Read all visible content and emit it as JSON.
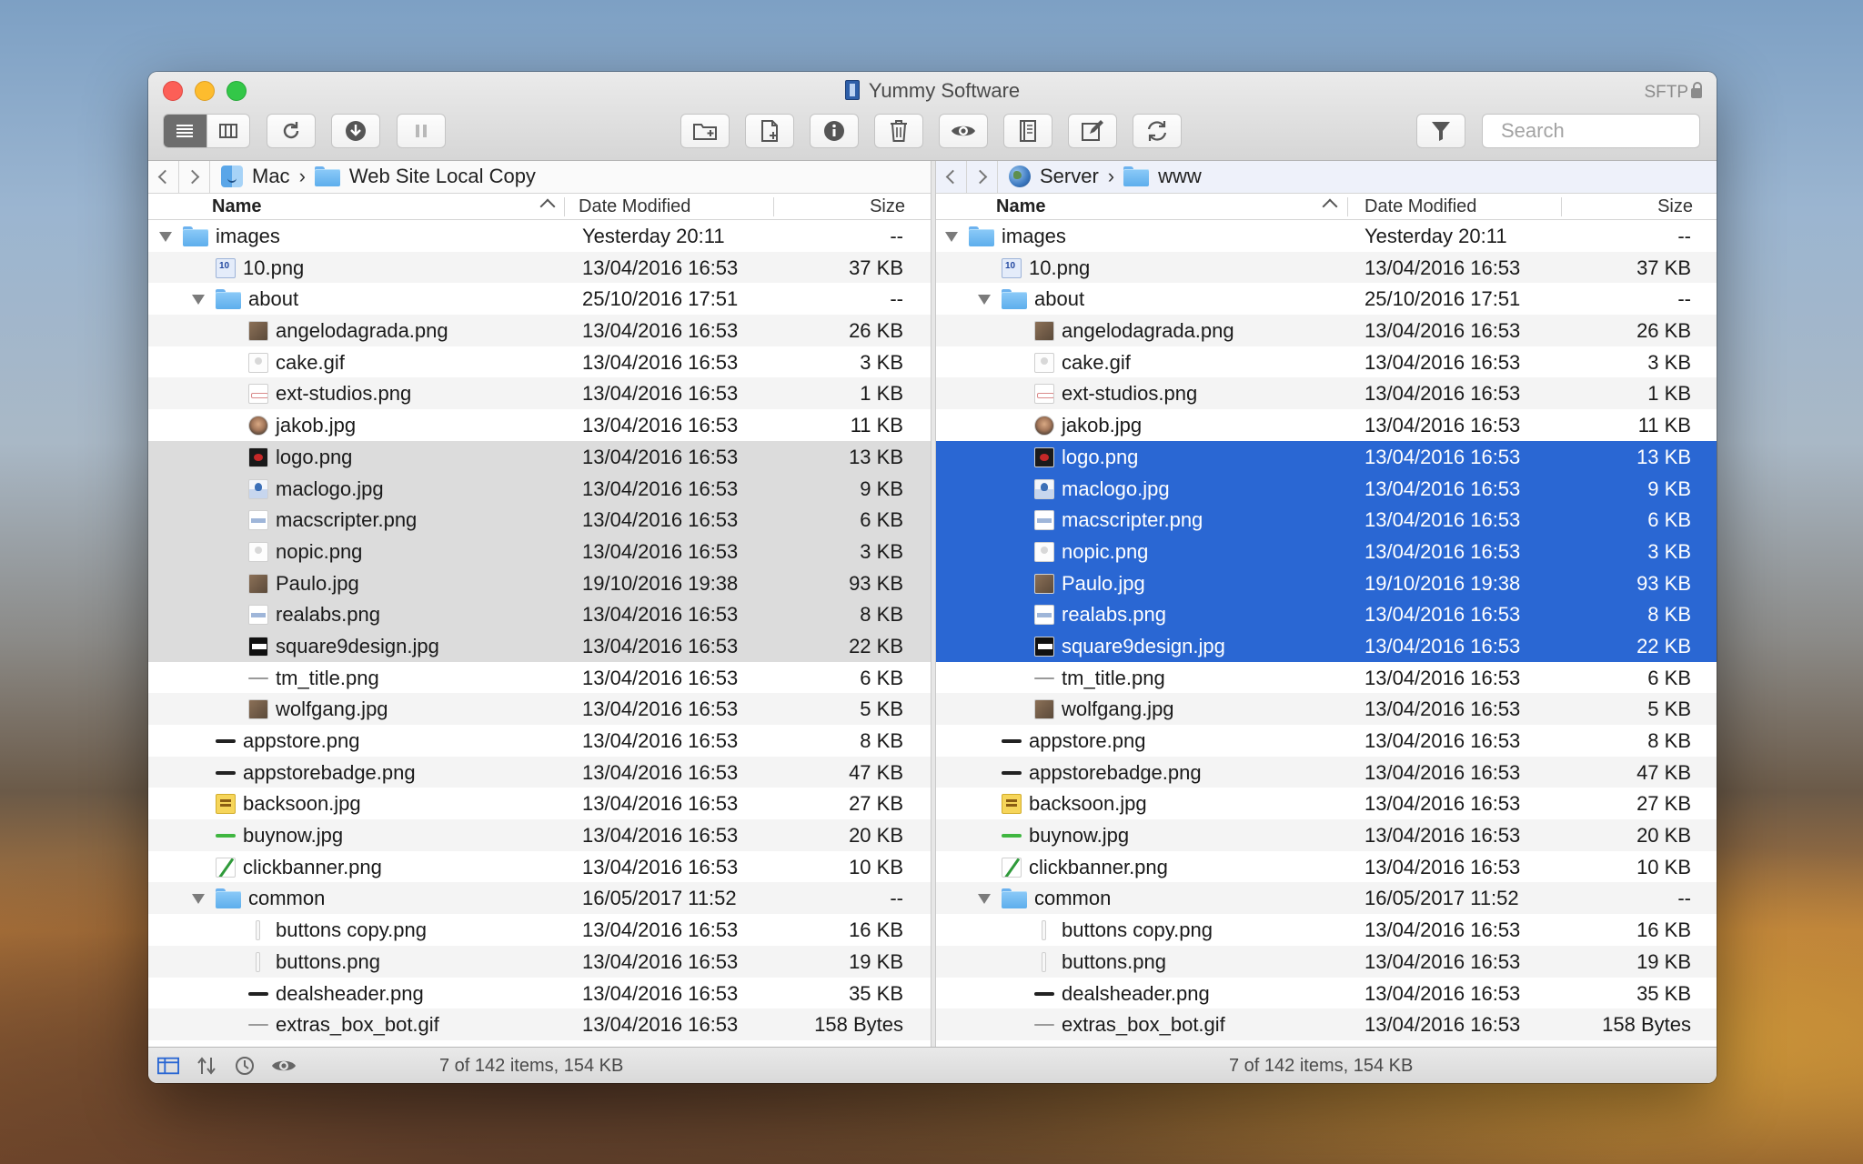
{
  "window": {
    "title": "Yummy Software",
    "protocol": "SFTP"
  },
  "toolbar": {
    "search_placeholder": "Search"
  },
  "left": {
    "crumbs": [
      "Mac",
      "Web Site Local Copy"
    ],
    "columns": {
      "name": "Name",
      "date": "Date Modified",
      "size": "Size"
    },
    "status": "7 of 142 items, 154 KB"
  },
  "right": {
    "crumbs": [
      "Server",
      "www"
    ],
    "columns": {
      "name": "Name",
      "date": "Date Modified",
      "size": "Size"
    },
    "status": "7 of 142 items, 154 KB"
  },
  "rows": [
    {
      "name": "images",
      "date": "Yesterday 20:11",
      "size": "--",
      "depth": 0,
      "type": "folder"
    },
    {
      "name": "10.png",
      "date": "13/04/2016 16:53",
      "size": "37 KB",
      "depth": 1,
      "type": "num"
    },
    {
      "name": "about",
      "date": "25/10/2016 17:51",
      "size": "--",
      "depth": 1,
      "type": "folder"
    },
    {
      "name": "angelodagrada.png",
      "date": "13/04/2016 16:53",
      "size": "26 KB",
      "depth": 2,
      "type": "photo"
    },
    {
      "name": "cake.gif",
      "date": "13/04/2016 16:53",
      "size": "3 KB",
      "depth": 2,
      "type": "blank"
    },
    {
      "name": "ext-studios.png",
      "date": "13/04/2016 16:53",
      "size": "1 KB",
      "depth": 2,
      "type": "red"
    },
    {
      "name": "jakob.jpg",
      "date": "13/04/2016 16:53",
      "size": "11 KB",
      "depth": 2,
      "type": "face"
    },
    {
      "name": "logo.png",
      "date": "13/04/2016 16:53",
      "size": "13 KB",
      "depth": 2,
      "type": "dark",
      "selected": true
    },
    {
      "name": "maclogo.jpg",
      "date": "13/04/2016 16:53",
      "size": "9 KB",
      "depth": 2,
      "type": "mac",
      "selected": true
    },
    {
      "name": "macscripter.png",
      "date": "13/04/2016 16:53",
      "size": "6 KB",
      "depth": 2,
      "type": "strip",
      "selected": true
    },
    {
      "name": "nopic.png",
      "date": "13/04/2016 16:53",
      "size": "3 KB",
      "depth": 2,
      "type": "blank",
      "selected": true
    },
    {
      "name": "Paulo.jpg",
      "date": "19/10/2016 19:38",
      "size": "93 KB",
      "depth": 2,
      "type": "photo",
      "selected": true
    },
    {
      "name": "realabs.png",
      "date": "13/04/2016 16:53",
      "size": "8 KB",
      "depth": 2,
      "type": "strip",
      "selected": true
    },
    {
      "name": "square9design.jpg",
      "date": "13/04/2016 16:53",
      "size": "22 KB",
      "depth": 2,
      "type": "square",
      "selected": true
    },
    {
      "name": "tm_title.png",
      "date": "13/04/2016 16:53",
      "size": "6 KB",
      "depth": 2,
      "type": "thin"
    },
    {
      "name": "wolfgang.jpg",
      "date": "13/04/2016 16:53",
      "size": "5 KB",
      "depth": 2,
      "type": "photo"
    },
    {
      "name": "appstore.png",
      "date": "13/04/2016 16:53",
      "size": "8 KB",
      "depth": 1,
      "type": "bar"
    },
    {
      "name": "appstorebadge.png",
      "date": "13/04/2016 16:53",
      "size": "47 KB",
      "depth": 1,
      "type": "bar"
    },
    {
      "name": "backsoon.jpg",
      "date": "13/04/2016 16:53",
      "size": "27 KB",
      "depth": 1,
      "type": "yellow"
    },
    {
      "name": "buynow.jpg",
      "date": "13/04/2016 16:53",
      "size": "20 KB",
      "depth": 1,
      "type": "green"
    },
    {
      "name": "clickbanner.png",
      "date": "13/04/2016 16:53",
      "size": "10 KB",
      "depth": 1,
      "type": "pencil"
    },
    {
      "name": "common",
      "date": "16/05/2017 11:52",
      "size": "--",
      "depth": 1,
      "type": "folder"
    },
    {
      "name": "buttons copy.png",
      "date": "13/04/2016 16:53",
      "size": "16 KB",
      "depth": 2,
      "type": "slim"
    },
    {
      "name": "buttons.png",
      "date": "13/04/2016 16:53",
      "size": "19 KB",
      "depth": 2,
      "type": "slim"
    },
    {
      "name": "dealsheader.png",
      "date": "13/04/2016 16:53",
      "size": "35 KB",
      "depth": 2,
      "type": "bar"
    },
    {
      "name": "extras_box_bot.gif",
      "date": "13/04/2016 16:53",
      "size": "158 Bytes",
      "depth": 2,
      "type": "thin"
    }
  ],
  "colors": {
    "selection_blue": "#2a67d3",
    "selection_gray": "#dcdcdc",
    "folder_blue": "#5daeec"
  },
  "icons": {
    "toolbar": [
      "list-view-icon",
      "column-view-icon",
      "refresh-icon",
      "download-icon",
      "pause-icon",
      "new-folder-icon",
      "new-file-icon",
      "info-icon",
      "trash-icon",
      "eye-icon",
      "book-icon",
      "edit-icon",
      "sync-icon",
      "filter-icon"
    ],
    "status": [
      "split-view-icon",
      "transfer-icon",
      "clock-icon",
      "eye-icon"
    ]
  }
}
